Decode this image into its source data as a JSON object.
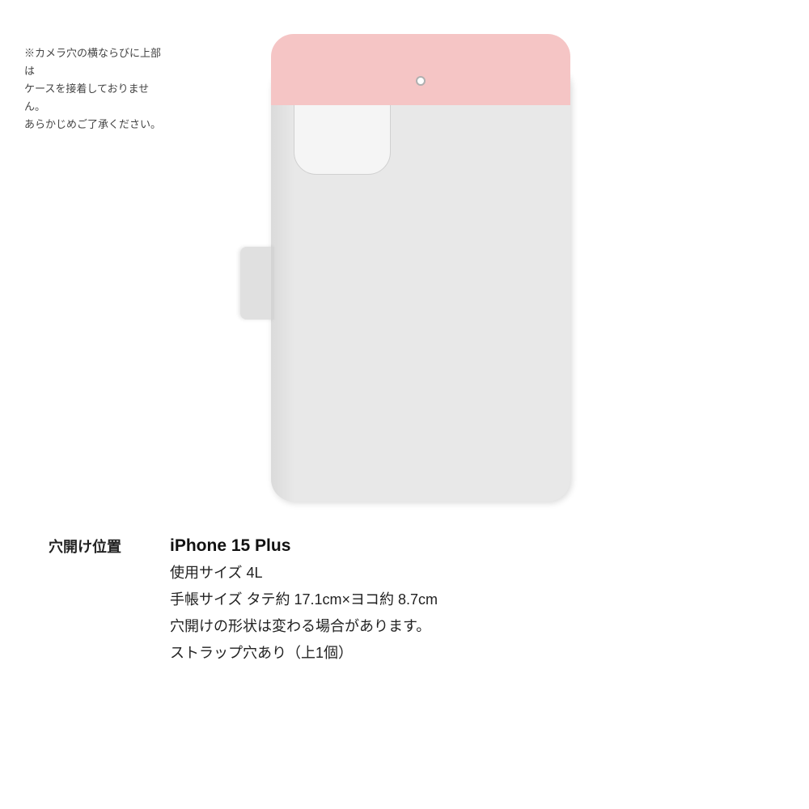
{
  "page": {
    "background": "#ffffff"
  },
  "note": {
    "line1": "※カメラ穴の横ならびに上部は",
    "line2": "ケースを接着しておりません。",
    "line3": "あらかじめご了承ください。"
  },
  "label": {
    "text": "穴開け位置"
  },
  "details": {
    "device_name": "iPhone 15 Plus",
    "size_label": "使用サイズ 4L",
    "notebook_size": "手帳サイズ タテ約 17.1cm×ヨコ約 8.7cm",
    "hole_shape": "穴開けの形状は変わる場合があります。",
    "strap": "ストラップ穴あり（上1個）"
  }
}
